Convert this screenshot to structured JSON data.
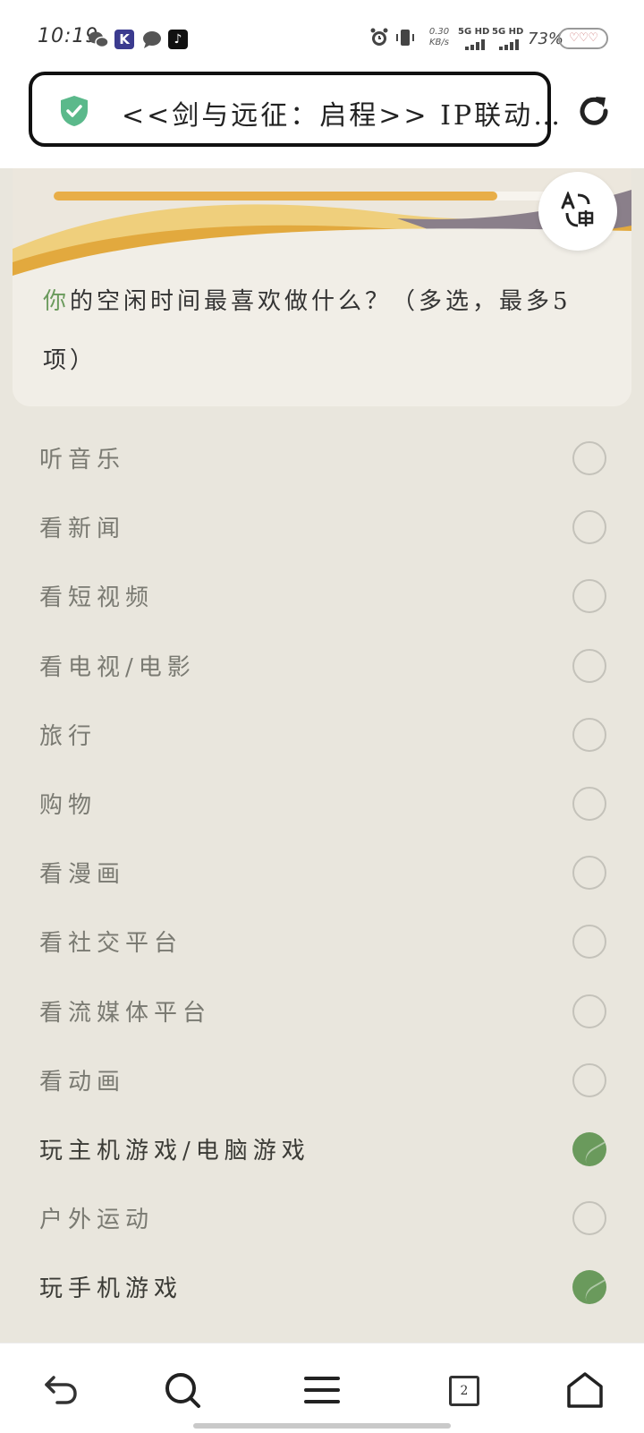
{
  "status_bar": {
    "time": "10:19",
    "app_icons": [
      "wechat-icon",
      "k-app-icon",
      "message-icon",
      "tiktok-icon"
    ],
    "net_speed_value": "0.30",
    "net_speed_unit": "KB/s",
    "signal1_label": "5G HD",
    "signal2_label": "5G HD",
    "battery": "73%",
    "k_app_letter": "K",
    "tiktok_glyph": "♪"
  },
  "address_bar": {
    "url_text": "<<剑与远征：启程>> IP联动…",
    "secure": true
  },
  "survey": {
    "progress": 0.87,
    "question_accent": "你",
    "question_rest": "的空闲时间最喜欢做什么？（多选，最多5项）",
    "options": [
      {
        "label": "听音乐",
        "selected": false
      },
      {
        "label": "看新闻",
        "selected": false
      },
      {
        "label": "看短视频",
        "selected": false
      },
      {
        "label": "看电视/电影",
        "selected": false
      },
      {
        "label": "旅行",
        "selected": false
      },
      {
        "label": "购物",
        "selected": false
      },
      {
        "label": "看漫画",
        "selected": false
      },
      {
        "label": "看社交平台",
        "selected": false
      },
      {
        "label": "看流媒体平台",
        "selected": false
      },
      {
        "label": "看动画",
        "selected": false
      },
      {
        "label": "玩主机游戏/电脑游戏",
        "selected": true
      },
      {
        "label": "户外运动",
        "selected": false
      },
      {
        "label": "玩手机游戏",
        "selected": true
      }
    ],
    "accent_color": "#6a9a5c",
    "progress_color": "#e8ae48"
  },
  "bottom_nav": {
    "tab_count": "2",
    "icons": [
      "back-arrow-icon",
      "search-icon",
      "menu-icon",
      "tabs-icon",
      "home-icon"
    ]
  }
}
